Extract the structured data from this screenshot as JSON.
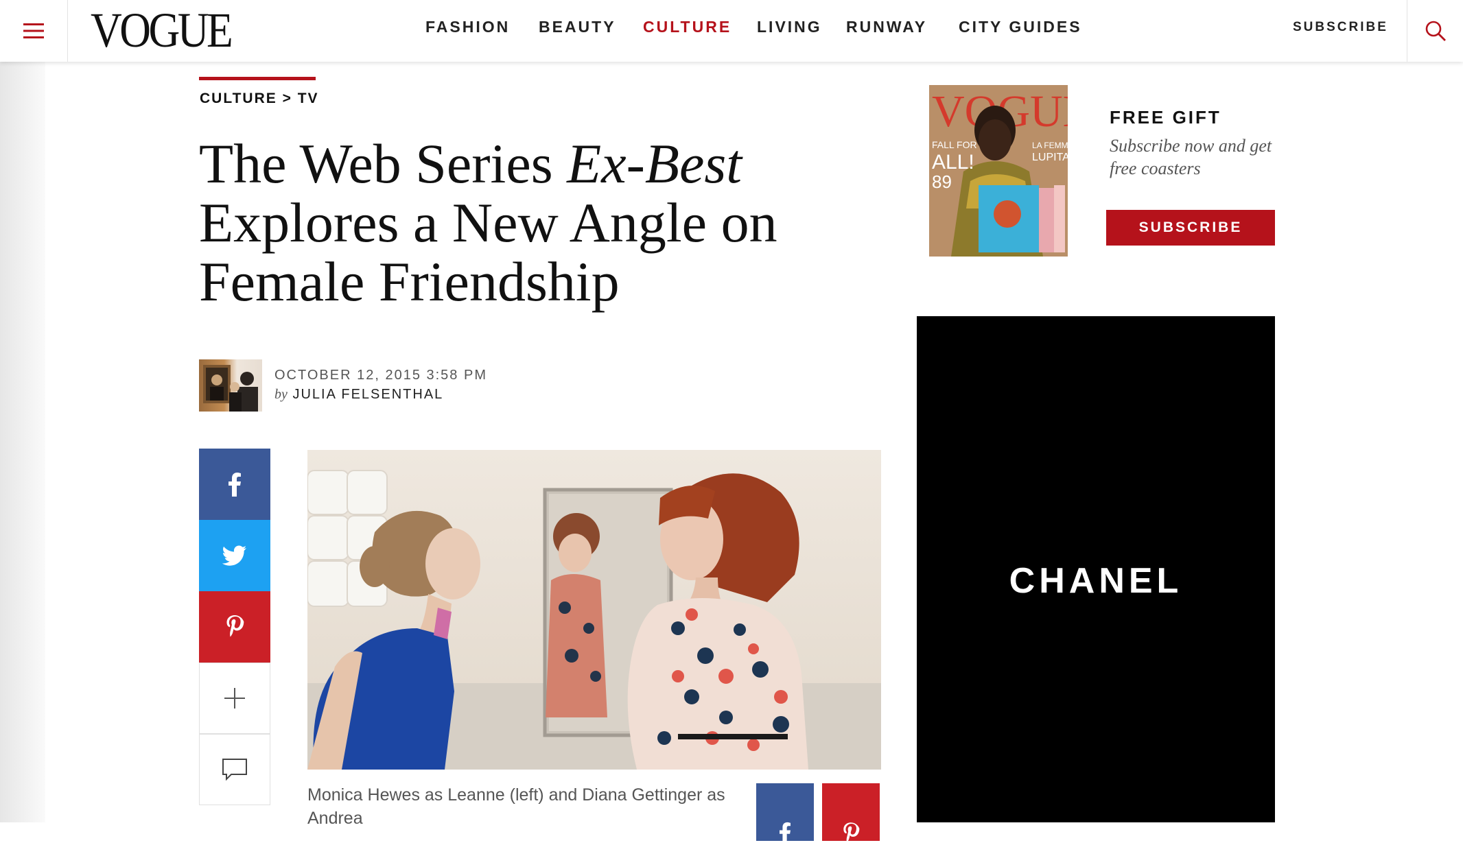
{
  "header": {
    "logo": "VOGUE",
    "nav": [
      {
        "label": "FASHION",
        "active": false
      },
      {
        "label": "BEAUTY",
        "active": false
      },
      {
        "label": "CULTURE",
        "active": true
      },
      {
        "label": "LIVING",
        "active": false
      },
      {
        "label": "RUNWAY",
        "active": false
      },
      {
        "label": "CITY GUIDES",
        "active": false
      }
    ],
    "subscribe_label": "SUBSCRIBE",
    "menu_icon": "hamburger-icon",
    "search_icon": "search-icon"
  },
  "article": {
    "breadcrumb": {
      "section": "CULTURE",
      "separator": ">",
      "subsection": "TV"
    },
    "headline": {
      "line1_pre": "The Web Series ",
      "line1_italic": "Ex-Best",
      "line2": "Explores a New Angle on",
      "line3": "Female Friendship"
    },
    "date": "OCTOBER 12, 2015 3:58 PM",
    "by_prefix": "by",
    "author": "JULIA FELSENTHAL",
    "caption": "Monica Hewes as Leanne (left) and Diana Gettinger as Andrea"
  },
  "share": {
    "facebook_icon": "facebook-icon",
    "twitter_icon": "twitter-icon",
    "pinterest_icon": "pinterest-icon",
    "plus_icon": "plus-icon",
    "comment_icon": "comment-icon"
  },
  "sidebar": {
    "free_gift_title": "FREE GIFT",
    "free_gift_desc": "Subscribe now and get free coasters",
    "subscribe_button": "SUBSCRIBE",
    "ad_text": "CHANEL"
  },
  "colors": {
    "accent_red": "#b5121b",
    "facebook": "#3b5998",
    "twitter": "#1da1f2",
    "pinterest": "#cb2027"
  }
}
